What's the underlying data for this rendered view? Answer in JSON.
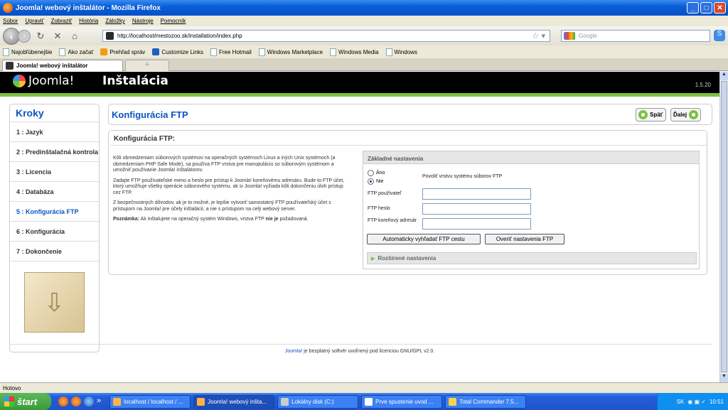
{
  "window": {
    "title": "Joomla! webový inštalátor - Mozilla Firefox"
  },
  "menu": [
    "Súbor",
    "Upraviť",
    "Zobraziť",
    "História",
    "Záložky",
    "Nástroje",
    "Pomocník"
  ],
  "nav": {
    "url": "http://localhost/mestozoo.sk/installation/index.php",
    "search_placeholder": "Google"
  },
  "bookmarks": [
    "Najobľúbenejšie",
    "Ako začať",
    "Prehľad správ",
    "Customize Links",
    "Free Hotmail",
    "Windows Marketplace",
    "Windows Media",
    "Windows"
  ],
  "tab": {
    "label": "Joomla! webový inštalátor",
    "new": "+"
  },
  "header": {
    "logo": "Joomla!",
    "title": "Inštalácia",
    "version": "1.5.20"
  },
  "sidebar": {
    "title": "Kroky",
    "steps": [
      "1 : Jazyk",
      "2 : Predinštalačná kontrola",
      "3 : Licencia",
      "4 : Databáza",
      "5 : Konfigurácia FTP",
      "6 : Konfigurácia",
      "7 : Dokončenie"
    ],
    "active_index": 4
  },
  "main": {
    "title": "Konfigurácia FTP",
    "back_label": "Späť",
    "next_label": "Ďalej",
    "panel_title": "Konfigurácia FTP:",
    "desc1": "Kôli obmedzeniam súborových systémov na operačných systémoch Linux a iných Unix systémoch (a obmedzeniam PHP Safe Mode), sa používa FTP vrstva pre manupuláciu so súborovým systémom a umožniť používanie Joomla! inštalátorov.",
    "desc2": "Zadajte FTP používateľské meno a heslo pre prístup k Joomla! koreňovému adresáru. Bude to FTP účet, ktorý umožňuje všetky operácie súborového systému, ak si Joomla! vyžiada kôli dokončeniu úloh prístup cez FTP.",
    "desc3": "Z bezpečnostných dôvodov, ak je to možné, je lepšie vytvoriť samostatný FTP používateľský účet s prístupom na Joomla! pre účely inštalácií, a nie s prístupom na celý webový server.",
    "note_label": "Poznámka:",
    "note_text_a": " Ak inštalujete na operačný systém Windows, vrstva FTP ",
    "note_bold": "nie je",
    "note_text_b": " požadovaná."
  },
  "settings": {
    "legend": "Základné nastavenia",
    "radio_yes": "Áno",
    "radio_no": "Nie",
    "radio_selected": "Nie",
    "enable_label": "Povoliť vrstvu systému súborov FTP",
    "user_label": "FTP používateľ",
    "pass_label": "FTP heslo",
    "root_label": "FTP koreňový adresár",
    "user_value": "",
    "pass_value": "",
    "root_value": "",
    "autodetect_btn": "Automaticky vyhľadať FTP cestu",
    "verify_btn": "Overiť nastavenia FTP",
    "advanced": "Rozšírené nastavenia"
  },
  "footer": {
    "link": "Joomla!",
    "text": " je bezplatný softvér uvoľnený pod licenciou GNU/GPL v2.0."
  },
  "status": "Hotovo",
  "taskbar": {
    "start": "štart",
    "tasks": [
      "localhost / localhost / ...",
      "Joomla! webový inšta...",
      "Lokálny disk (C:)",
      "Prve spustenie uvod ...",
      "Total Commander 7.5..."
    ],
    "active_task": 1,
    "lang": "SK",
    "clock": "10:51"
  },
  "colors": {
    "accent": "#0b55c4",
    "green": "#7fbf3f"
  }
}
